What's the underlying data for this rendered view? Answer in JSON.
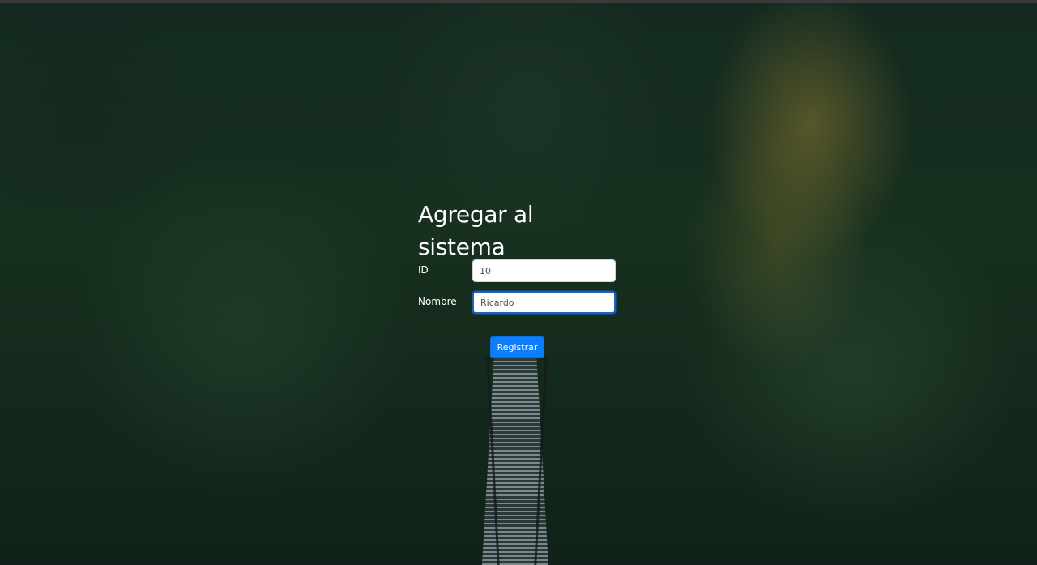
{
  "form": {
    "title": "Agregar al sistema",
    "id_label": "ID",
    "id_value": "10",
    "nombre_label": "Nombre",
    "nombre_value": "Ricardo",
    "submit_label": "Registrar"
  },
  "colors": {
    "accent": "#0d7dfb",
    "text": "#ffffff",
    "focus_border": "#1f5fbf"
  }
}
